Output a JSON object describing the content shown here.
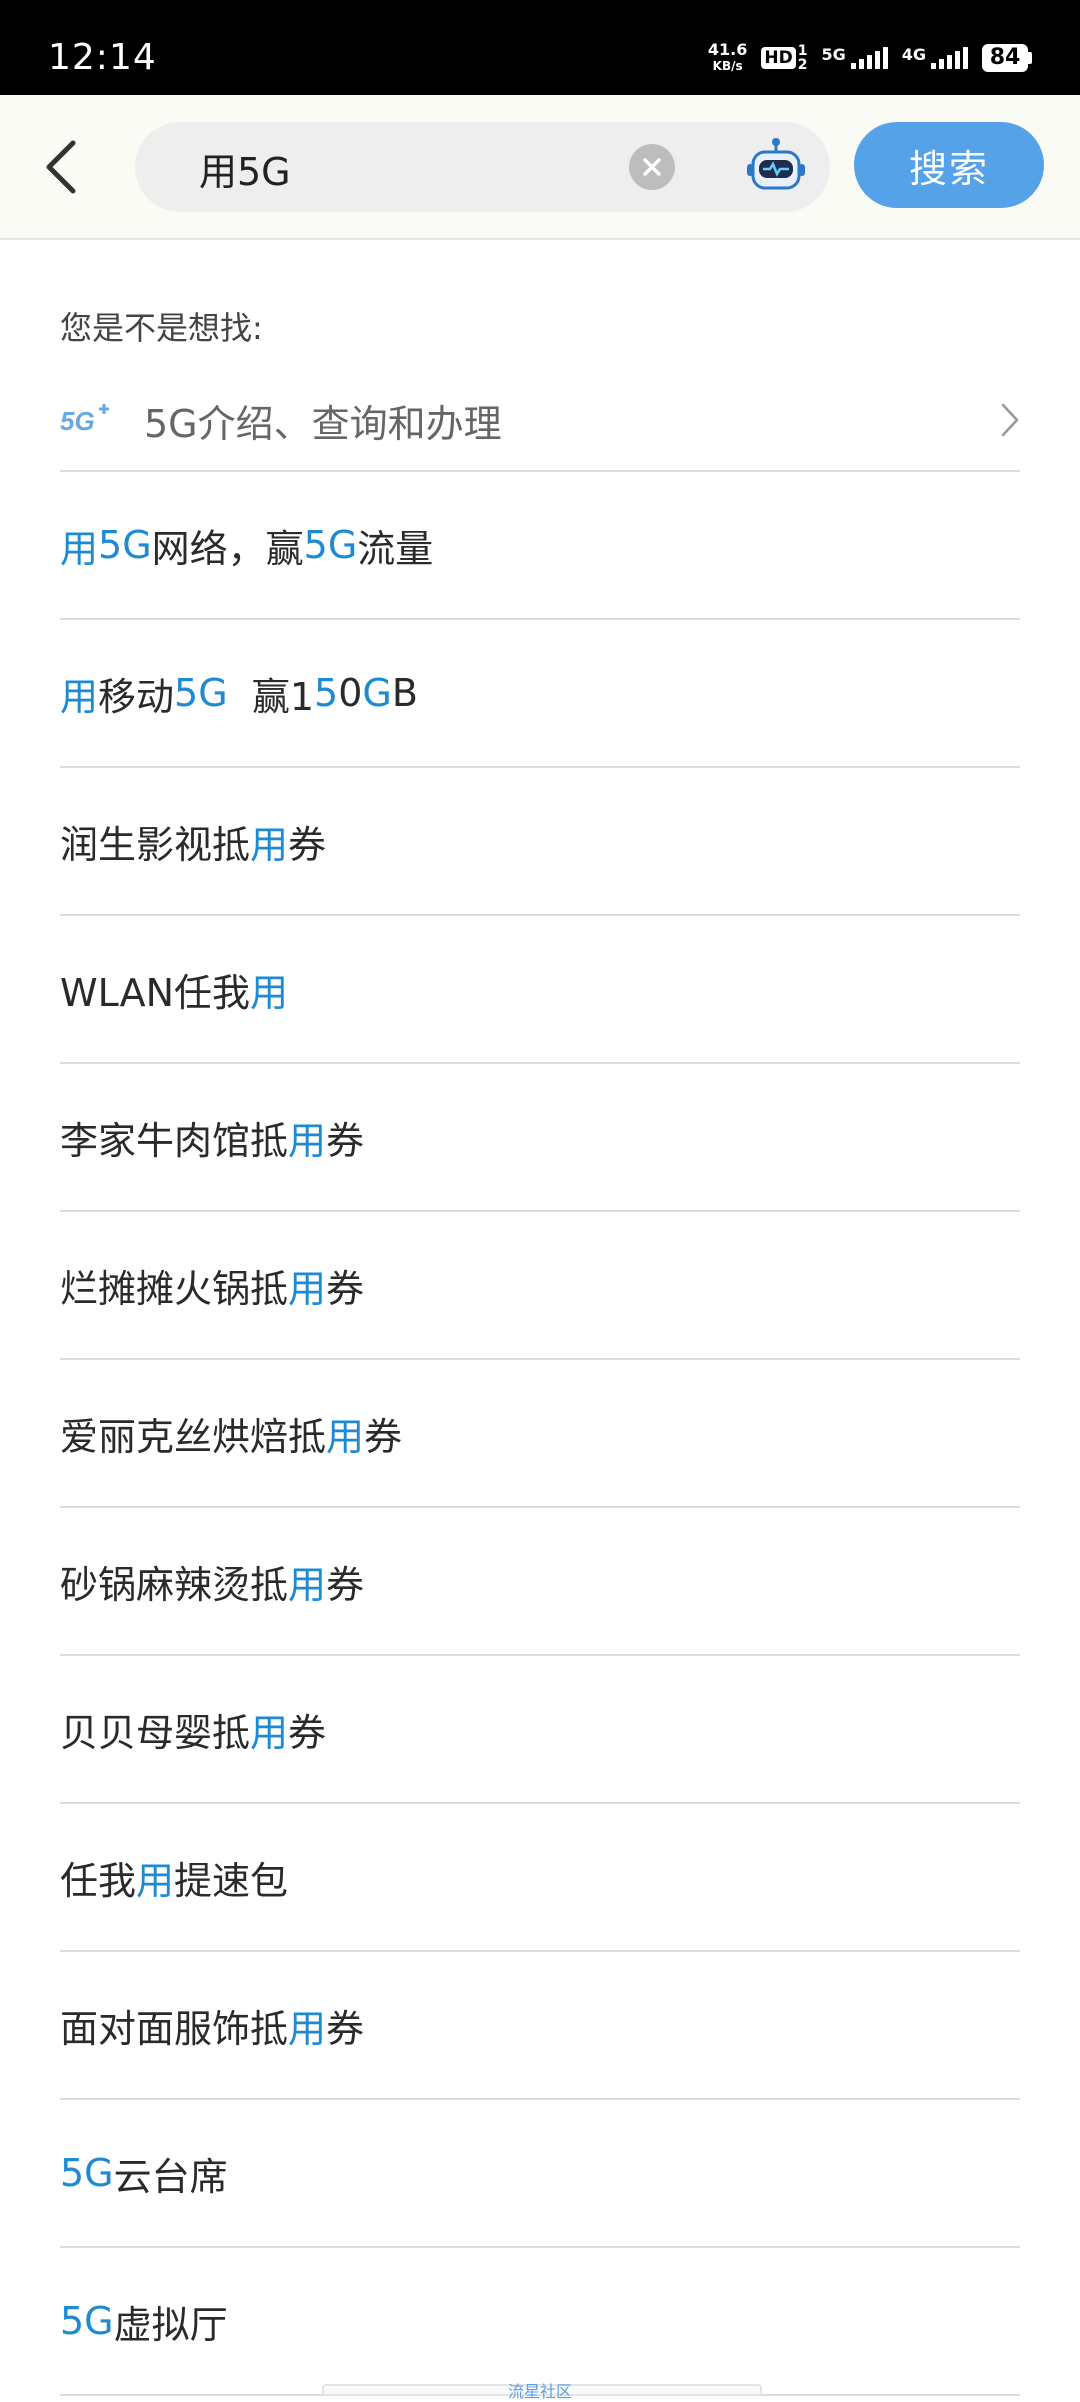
{
  "status_bar": {
    "time": "12:14",
    "net_speed": "41.6",
    "net_unit": "KB/s",
    "hd_label": "HD",
    "hd_sub_top": "1",
    "hd_sub_bottom": "2",
    "sim1_label": "5G",
    "sim2_label": "4G",
    "battery": "84"
  },
  "header": {
    "search_value": "用5G",
    "search_button": "搜索"
  },
  "suggest": {
    "label": "您是不是想找:",
    "logo_text": "5G",
    "item_text": "5G介绍、查询和办理"
  },
  "results": [
    {
      "segments": [
        {
          "t": "用",
          "h": true
        },
        {
          "t": "5G",
          "h": true
        },
        {
          "t": "网络，赢",
          "h": false
        },
        {
          "t": "5G",
          "h": true
        },
        {
          "t": "流量",
          "h": false
        }
      ]
    },
    {
      "segments": [
        {
          "t": "用",
          "h": true
        },
        {
          "t": "移动",
          "h": false
        },
        {
          "t": "5G",
          "h": true
        },
        {
          "t": "  赢1",
          "h": false
        },
        {
          "t": "5",
          "h": true
        },
        {
          "t": "0",
          "h": false
        },
        {
          "t": "G",
          "h": true
        },
        {
          "t": "B",
          "h": false
        }
      ]
    },
    {
      "segments": [
        {
          "t": "润生影视抵",
          "h": false
        },
        {
          "t": "用",
          "h": true
        },
        {
          "t": "券",
          "h": false
        }
      ]
    },
    {
      "segments": [
        {
          "t": "WLAN任我",
          "h": false
        },
        {
          "t": "用",
          "h": true
        }
      ]
    },
    {
      "segments": [
        {
          "t": "李家牛肉馆抵",
          "h": false
        },
        {
          "t": "用",
          "h": true
        },
        {
          "t": "券",
          "h": false
        }
      ]
    },
    {
      "segments": [
        {
          "t": "烂摊摊火锅抵",
          "h": false
        },
        {
          "t": "用",
          "h": true
        },
        {
          "t": "券",
          "h": false
        }
      ]
    },
    {
      "segments": [
        {
          "t": "爱丽克丝烘焙抵",
          "h": false
        },
        {
          "t": "用",
          "h": true
        },
        {
          "t": "券",
          "h": false
        }
      ]
    },
    {
      "segments": [
        {
          "t": "砂锅麻辣烫抵",
          "h": false
        },
        {
          "t": "用",
          "h": true
        },
        {
          "t": "券",
          "h": false
        }
      ]
    },
    {
      "segments": [
        {
          "t": "贝贝母婴抵",
          "h": false
        },
        {
          "t": "用",
          "h": true
        },
        {
          "t": "券",
          "h": false
        }
      ]
    },
    {
      "segments": [
        {
          "t": "任我",
          "h": false
        },
        {
          "t": "用",
          "h": true
        },
        {
          "t": "提速包",
          "h": false
        }
      ]
    },
    {
      "segments": [
        {
          "t": "面对面服饰抵",
          "h": false
        },
        {
          "t": "用",
          "h": true
        },
        {
          "t": "券",
          "h": false
        }
      ]
    },
    {
      "segments": [
        {
          "t": "5G",
          "h": true
        },
        {
          "t": "云台席",
          "h": false
        }
      ]
    },
    {
      "segments": [
        {
          "t": "5G",
          "h": true
        },
        {
          "t": "虚拟厅",
          "h": false
        }
      ]
    }
  ],
  "footer": {
    "watermark": "流星社区"
  },
  "colors": {
    "highlight": "#1e8ad2",
    "search_button": "#55a2e8",
    "header_bg": "#fbfbf5"
  }
}
